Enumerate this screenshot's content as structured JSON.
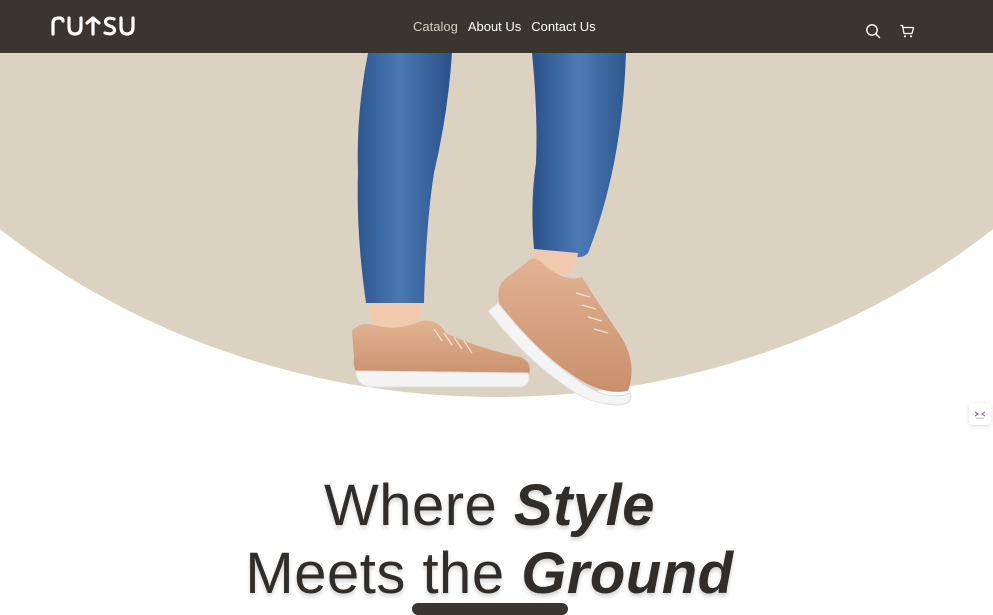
{
  "brand": {
    "logo_text": "rutsu"
  },
  "nav": {
    "items": [
      {
        "label": "Catalog",
        "active": true
      },
      {
        "label": "About Us",
        "active": false
      },
      {
        "label": "Contact Us",
        "active": false
      }
    ],
    "icons": [
      "search-icon",
      "cart-icon"
    ]
  },
  "hero": {
    "headline_line1_plain": "Where ",
    "headline_line1_emph": "Style",
    "headline_line2_plain": "Meets the ",
    "headline_line2_emph": "Ground"
  },
  "colors": {
    "nav_bg": "#3a3531",
    "nav_active": "#d8cdbd",
    "hero_beige": "#dcd2c2",
    "headline": "#312d2a",
    "denim": "#3a66a1",
    "shoe": "#d8a583"
  }
}
